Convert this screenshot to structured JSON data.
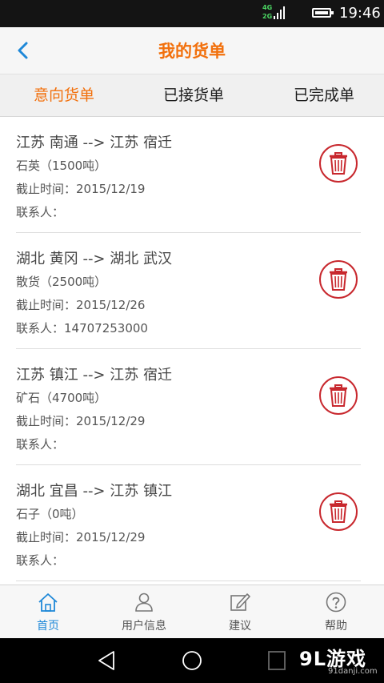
{
  "status_bar": {
    "network_top": "4G",
    "network_bottom": "2G",
    "time": "19:46"
  },
  "header": {
    "title": "我的货单",
    "back_icon": "chevron-left-icon",
    "accent_color": "#f2700c"
  },
  "tabs": [
    {
      "label": "意向货单",
      "active": true
    },
    {
      "label": "已接货单",
      "active": false
    },
    {
      "label": "已完成单",
      "active": false
    }
  ],
  "orders": [
    {
      "route": "江苏 南通 --> 江苏 宿迁",
      "cargo": "石英（1500吨）",
      "deadline": "截止时间：2015/12/19",
      "contact": "联系人："
    },
    {
      "route": "湖北 黄冈 --> 湖北 武汉",
      "cargo": "散货（2500吨）",
      "deadline": "截止时间：2015/12/26",
      "contact": "联系人：14707253000"
    },
    {
      "route": "江苏 镇江 --> 江苏 宿迁",
      "cargo": "矿石（4700吨）",
      "deadline": "截止时间：2015/12/29",
      "contact": "联系人："
    },
    {
      "route": "湖北 宜昌 --> 江苏 镇江",
      "cargo": "石子（0吨）",
      "deadline": "截止时间：2015/12/29",
      "contact": "联系人："
    }
  ],
  "delete_icon": "trash-icon",
  "bottom_nav": [
    {
      "label": "首页",
      "icon": "home-icon",
      "active": true
    },
    {
      "label": "用户信息",
      "icon": "user-icon",
      "active": false
    },
    {
      "label": "建议",
      "icon": "edit-icon",
      "active": false
    },
    {
      "label": "帮助",
      "icon": "help-icon",
      "active": false
    }
  ],
  "watermark": {
    "main": "9L游戏",
    "sub": "91danji.com"
  },
  "colors": {
    "active_nav": "#1e88d8",
    "delete_red": "#c8282e"
  }
}
